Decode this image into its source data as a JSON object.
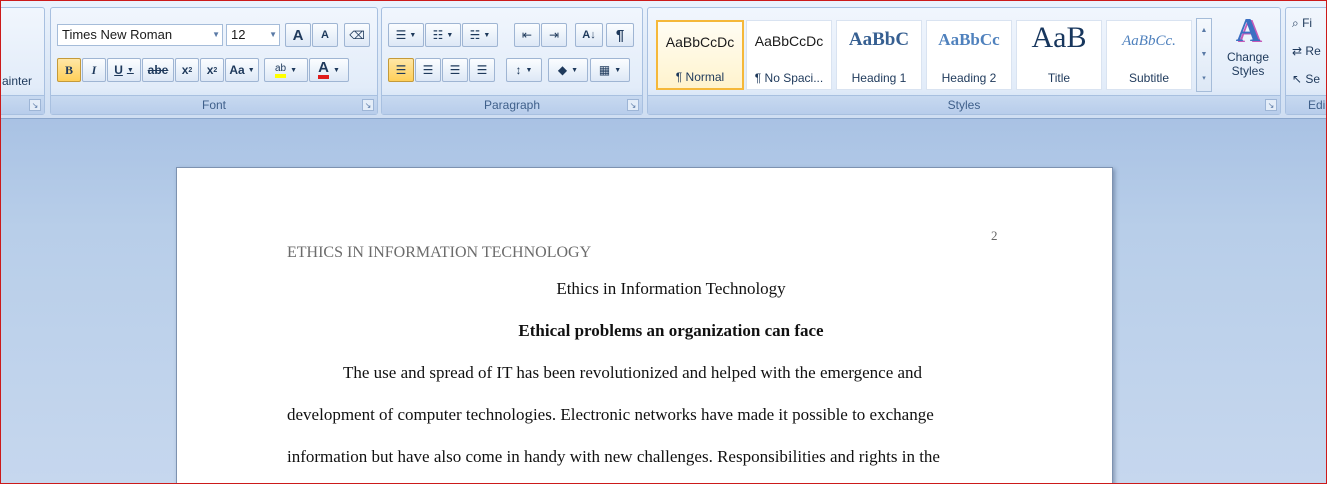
{
  "ribbon": {
    "clipboard": {
      "painter_label": "ainter"
    },
    "font": {
      "label": "Font",
      "font_name": "Times New Roman",
      "font_size": "12",
      "grow_font": "A",
      "shrink_font": "A",
      "bold": "B",
      "italic": "I",
      "underline": "U",
      "strikethrough": "abe",
      "subscript": "x",
      "superscript": "x",
      "change_case": "Aa",
      "highlight": "ab",
      "font_color": "A"
    },
    "paragraph": {
      "label": "Paragraph",
      "sort": "A↓",
      "show_marks": "¶"
    },
    "styles": {
      "label": "Styles",
      "items": [
        {
          "sample": "AaBbCcDc",
          "name": "¶ Normal"
        },
        {
          "sample": "AaBbCcDc",
          "name": "¶ No Spaci..."
        },
        {
          "sample": "AaBbC",
          "name": "Heading 1"
        },
        {
          "sample": "AaBbCc",
          "name": "Heading 2"
        },
        {
          "sample": "AaB",
          "name": "Title"
        },
        {
          "sample": "AaBbCc.",
          "name": "Subtitle"
        }
      ],
      "change_styles": "Change Styles"
    },
    "editing": {
      "label": "Edi",
      "find": "Fi",
      "replace": "Re",
      "select": "Se"
    }
  },
  "document": {
    "page_number": "2",
    "running_head": "ETHICS IN INFORMATION TECHNOLOGY",
    "title": "Ethics in Information Technology",
    "heading": "Ethical problems an organization can face",
    "paragraph_lines": [
      "The use and spread of IT has been revolutionized and helped with the emergence and",
      "development of computer technologies. Electronic networks have made it possible to exchange",
      "information but have also come in handy with new challenges. Responsibilities and rights in the"
    ]
  },
  "colors": {
    "ribbon": "#dbe7f6",
    "workspace": "#b8cee9",
    "accent": "#f5b83a",
    "frame": "#cc1a1a"
  }
}
